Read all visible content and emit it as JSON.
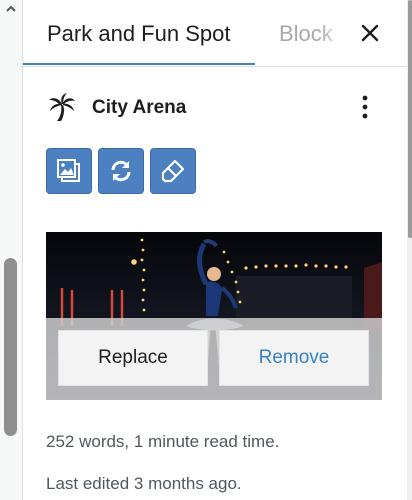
{
  "tabs": {
    "active_label": "Park and Fun Spot",
    "inactive_label": "Block"
  },
  "icons": {
    "close": "close-icon",
    "block": "palm-tree-icon",
    "more": "vertical-ellipsis-icon",
    "tools": [
      "media-library-icon",
      "replace-rotate-icon",
      "eraser-icon"
    ]
  },
  "block": {
    "title": "City Arena"
  },
  "image_actions": {
    "replace_label": "Replace",
    "remove_label": "Remove"
  },
  "meta": {
    "words": "252 words, 1 minute read time.",
    "edited": "Last edited 3 months ago."
  },
  "colors": {
    "accent": "#3582c4",
    "tool_button": "#4d80c1"
  }
}
